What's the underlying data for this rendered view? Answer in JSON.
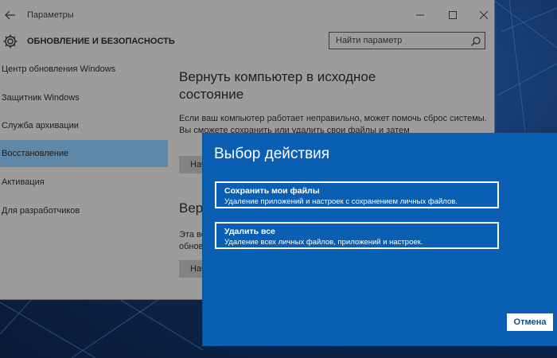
{
  "window": {
    "title": "Параметры",
    "section_title": "ОБНОВЛЕНИЕ И БЕЗОПАСНОСТЬ",
    "controls": [
      "minimize-icon",
      "maximize-icon",
      "close-icon"
    ]
  },
  "search": {
    "placeholder": "Найти параметр",
    "value": ""
  },
  "sidebar": {
    "items": [
      {
        "label": "Центр обновления Windows",
        "active": false
      },
      {
        "label": "Защитник Windows",
        "active": false
      },
      {
        "label": "Служба архивации",
        "active": false
      },
      {
        "label": "Восстановление",
        "active": true
      },
      {
        "label": "Активация",
        "active": false
      },
      {
        "label": "Для разработчиков",
        "active": false
      }
    ]
  },
  "content": {
    "heading": "Вернуть компьютер в исходное состояние",
    "text": "Если ваш компьютер работает неправильно, может помочь сброс системы. Вы сможете сохранить или удалить свои файлы и затем",
    "button1": "Начать",
    "heading2": "Верн",
    "text2": "Эта во обнов",
    "button2": "Нач"
  },
  "dialog": {
    "title": "Выбор действия",
    "options": [
      {
        "title": "Сохранить мои файлы",
        "desc": "Удаление приложений и настроек с сохранением личных файлов."
      },
      {
        "title": "Удалить все",
        "desc": "Удаление всех личных файлов, приложений и настроек."
      }
    ],
    "cancel_label": "Отмена"
  },
  "colors": {
    "dialog_bg": "#0a5fb2",
    "window_bg": "#9c9c9c",
    "active_item": "#5f88a8"
  }
}
